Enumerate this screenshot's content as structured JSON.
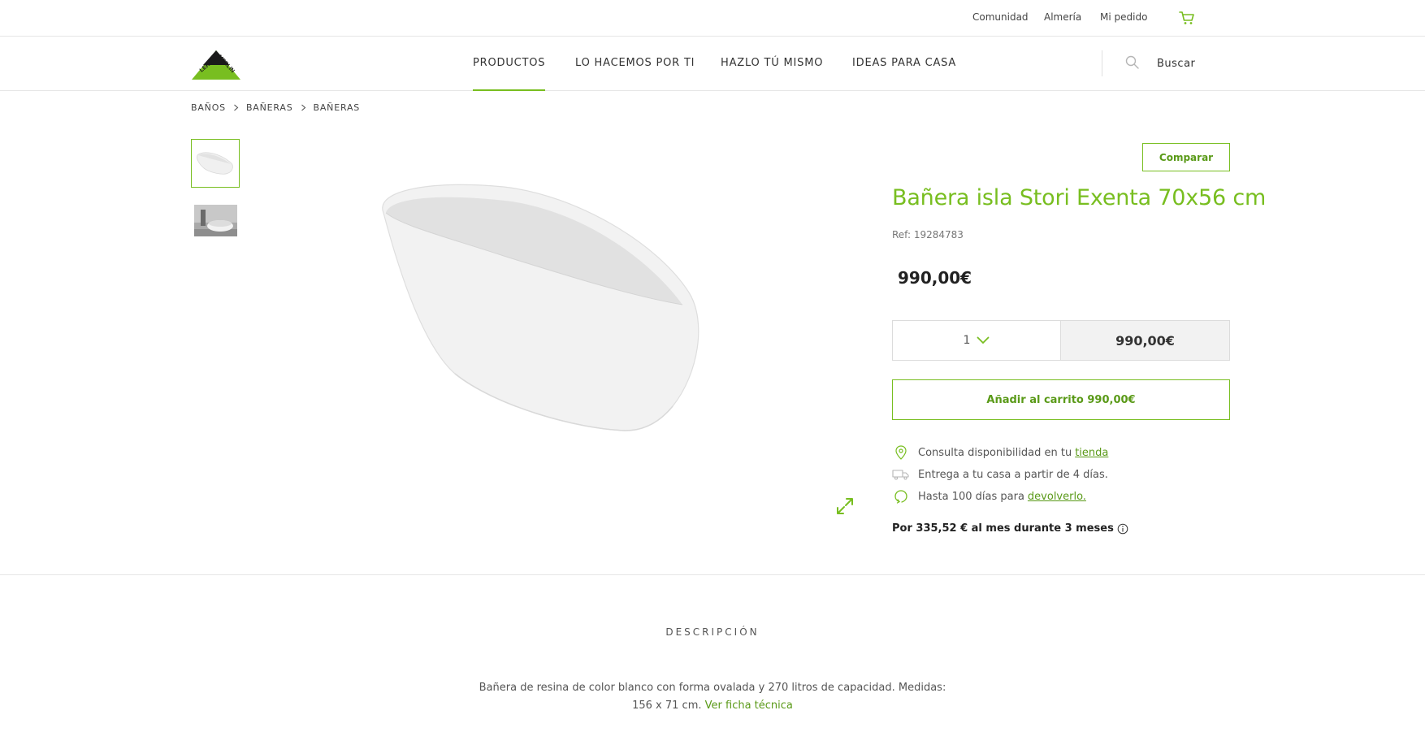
{
  "topbar": {
    "links": [
      "Comunidad",
      "Almería",
      "Mi pedido"
    ],
    "cart_icon": "cart-icon"
  },
  "brand": {
    "logo_text": "LEROY MERLIN",
    "accent": "#78be20"
  },
  "nav": {
    "items": [
      "PRODUCTOS",
      "LO HACEMOS POR TI",
      "HAZLO TÚ MISMO",
      "IDEAS PARA CASA"
    ],
    "active": "PRODUCTOS",
    "search_label": "Buscar"
  },
  "breadcrumb": [
    "BAÑOS",
    "BAÑERAS",
    "BAÑERAS"
  ],
  "product": {
    "compare_label": "Comparar",
    "title": "Bañera isla Stori Exenta 70x56 cm",
    "ref": "Ref: 19284783",
    "price": "990,00€",
    "quantity": "1",
    "total": "990,00€",
    "add_to_cart": "Añadir al carrito 990,00€",
    "availability_text": "Consulta disponibilidad en tu",
    "availability_link": "tienda",
    "delivery_text": "Entrega a tu casa a partir de 4 días.",
    "return_text": "Hasta 100 días para",
    "return_link": "devolverlo.",
    "finance_text": "Por 335,52 € al mes durante  3 meses"
  },
  "description": {
    "title": "DESCRIPCIÓN",
    "text": "Bañera de resina de color blanco con forma ovalada y 270 litros de capacidad. Medidas: 156 x 71 cm.",
    "link": "Ver ficha técnica"
  }
}
